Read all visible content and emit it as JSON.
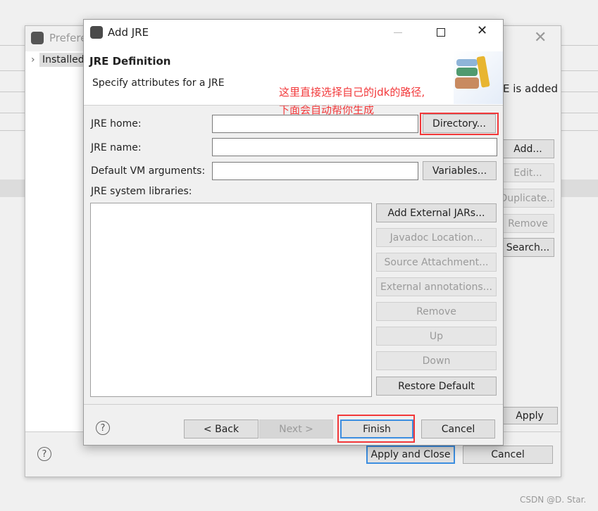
{
  "background_window": {
    "title": "Preferences",
    "tree_item": "Installed JREs",
    "partial_text": "E is added",
    "buttons": {
      "add": "Add...",
      "edit": "Edit...",
      "duplicate": "Duplicate...",
      "remove": "Remove",
      "search": "Search...",
      "apply": "Apply",
      "apply_close": "Apply and Close",
      "cancel": "Cancel"
    }
  },
  "dialog": {
    "title": "Add JRE",
    "heading": "JRE Definition",
    "subtitle": "Specify attributes for a JRE",
    "annotation_line1": "这里直接选择自己的jdk的路径,",
    "annotation_line2": "下面会自动帮你生成",
    "annotation_color": "#f2383a",
    "fields": {
      "jre_home_label": "JRE home:",
      "jre_home_value": "",
      "jre_name_label": "JRE name:",
      "jre_name_value": "",
      "vm_args_label": "Default VM arguments:",
      "vm_args_value": ""
    },
    "directory_button": "Directory...",
    "variables_button": "Variables...",
    "libraries_label": "JRE system libraries:",
    "library_buttons": {
      "add_external": "Add External JARs...",
      "javadoc": "Javadoc Location...",
      "source": "Source Attachment...",
      "external_annotations": "External annotations...",
      "remove": "Remove",
      "up": "Up",
      "down": "Down",
      "restore": "Restore Default"
    },
    "footer": {
      "back": "< Back",
      "next": "Next >",
      "finish": "Finish",
      "cancel": "Cancel"
    }
  },
  "watermark": "CSDN @D. Star."
}
